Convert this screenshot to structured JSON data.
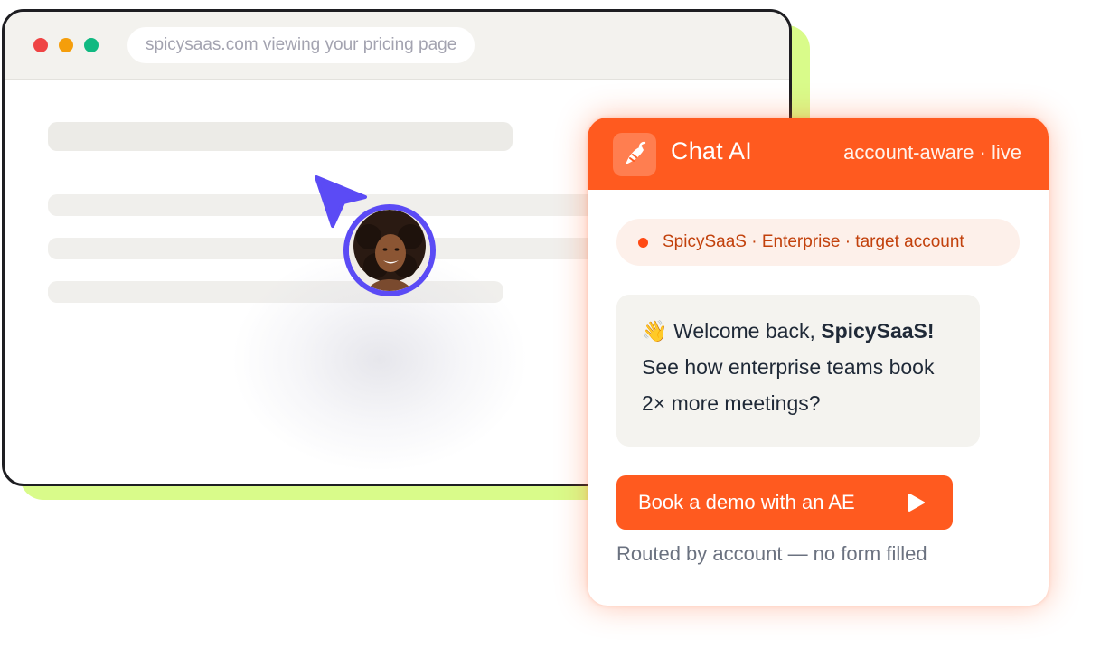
{
  "browser": {
    "url_text": "spicysaas.com viewing your pricing page"
  },
  "chat": {
    "title": "Chat AI",
    "status": "account-aware · live",
    "account_label": "SpicySaaS · Enterprise · target account",
    "message": {
      "greeting_prefix": "Welcome back, ",
      "company_name": "SpicySaaS!",
      "line2": "See how enterprise teams book",
      "line3": "2× more meetings?"
    },
    "cta_label": "Book a demo with an AE",
    "footnote": "Routed by account — no form filled"
  },
  "icons": {
    "window_controls": [
      "close-dot",
      "minimize-dot",
      "maximize-dot"
    ],
    "chat_logo": "chili-pepper-icon",
    "cursor": "cursor-arrow-icon",
    "wave": "waving-hand-emoji",
    "cta": "play-icon"
  },
  "colors": {
    "accent_orange": "#ff5a1f",
    "cursor_purple": "#5b4bf5",
    "lime_shadow": "#d9fb8a",
    "account_text": "#c2410c"
  }
}
